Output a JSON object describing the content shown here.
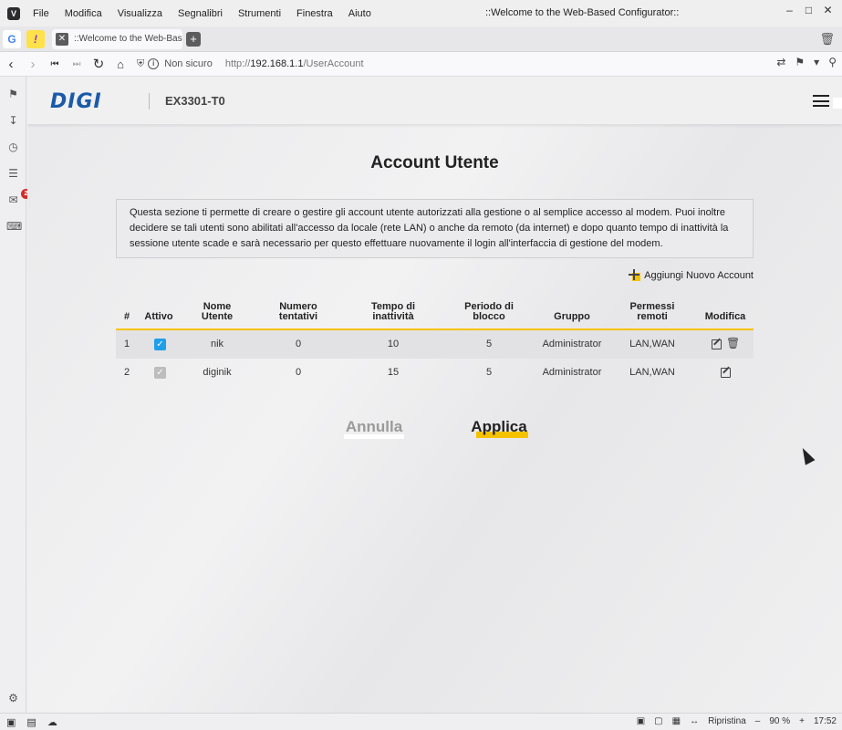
{
  "os_menu": {
    "items": [
      "File",
      "Modifica",
      "Visualizza",
      "Segnalibri",
      "Strumenti",
      "Finestra",
      "Aiuto"
    ],
    "window_title": "::Welcome to the Web-Based Configurator::"
  },
  "tabs": {
    "active_tab_title": "::Welcome to the Web-Bas"
  },
  "address_bar": {
    "security_label": "Non sicuro",
    "url_scheme": "http://",
    "url_host": "192.168.1.1",
    "url_path": "/UserAccount"
  },
  "sidebar": {
    "badge_count": "2"
  },
  "router": {
    "brand": "DIGI",
    "model": "EX3301-T0"
  },
  "page": {
    "title": "Account Utente",
    "description": "Questa sezione ti permette di creare o gestire gli account utente autorizzati alla gestione o al semplice accesso al modem. Puoi inoltre decidere se tali utenti sono abilitati all'accesso da locale (rete LAN) o anche da remoto (da internet) e dopo quanto tempo di inattività la sessione utente scade e sarà necessario per questo effettuare nuovamente il login all'interfaccia di gestione del modem.",
    "add_account_label": "Aggiungi Nuovo Account"
  },
  "table": {
    "headers": {
      "index": "#",
      "active": "Attivo",
      "username_l1": "Nome",
      "username_l2": "Utente",
      "attempts_l1": "Numero",
      "attempts_l2": "tentativi",
      "idle_l1": "Tempo di",
      "idle_l2": "inattività",
      "lock_l1": "Periodo di",
      "lock_l2": "blocco",
      "group": "Gruppo",
      "remote_l1": "Permessi",
      "remote_l2": "remoti",
      "modify": "Modifica"
    },
    "rows": [
      {
        "index": "1",
        "active": true,
        "username": "nik",
        "attempts": "0",
        "idle": "10",
        "lock": "5",
        "group": "Administrator",
        "remote": "LAN,WAN",
        "deletable": true
      },
      {
        "index": "2",
        "active": true,
        "username": "diginik",
        "attempts": "0",
        "idle": "15",
        "lock": "5",
        "group": "Administrator",
        "remote": "LAN,WAN",
        "deletable": false
      }
    ]
  },
  "actions": {
    "cancel_label": "Annulla",
    "apply_label": "Applica"
  },
  "status_bar": {
    "reset_label": "Ripristina",
    "zoom": "90 %",
    "time": "17:52"
  },
  "colors": {
    "accent_yellow": "#f6c200",
    "brand_blue": "#1a5aa8",
    "checkbox_blue": "#1e9fe8"
  }
}
